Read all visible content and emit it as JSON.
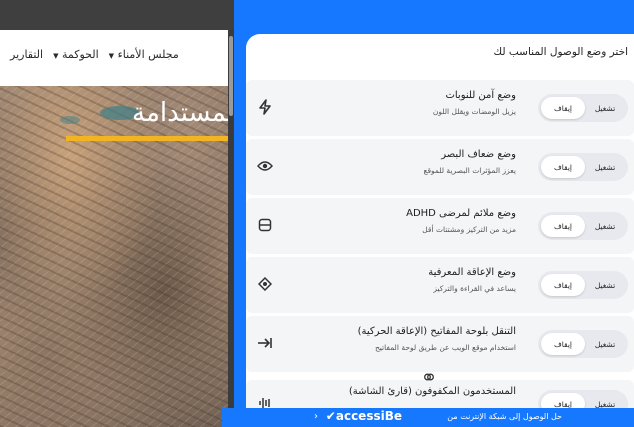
{
  "site": {
    "nav": [
      {
        "label": "مجلس الأمناء",
        "has_caret": true
      },
      {
        "label": "الحوكمة",
        "has_caret": true
      },
      {
        "label": "التقارير",
        "has_caret": false
      }
    ],
    "hero_title": "المستدامة"
  },
  "panel": {
    "heading": "اختر وضع الوصول المناسب لك",
    "profiles": [
      {
        "title": "وضع آمن للنوبات",
        "desc": "يزيل الومضات ويقلل اللون",
        "icon": "bolt-icon",
        "off_label": "إيقاف",
        "on_label": "تشغيل"
      },
      {
        "title": "وضع ضعاف البصر",
        "desc": "يعزز المؤثرات البصرية للموقع",
        "icon": "eye-icon",
        "off_label": "إيقاف",
        "on_label": "تشغيل"
      },
      {
        "title": "وضع ملائم لمرضى ADHD",
        "desc": "مزيد من التركيز ومشتتات أقل",
        "icon": "focus-icon",
        "off_label": "إيقاف",
        "on_label": "تشغيل"
      },
      {
        "title": "وضع الإعاقة المعرفية",
        "desc": "يساعد في القراءة والتركيز",
        "icon": "target-icon",
        "off_label": "إيقاف",
        "on_label": "تشغيل"
      },
      {
        "title": "التنقل بلوحة المفاتيح (الإعاقة الحركية)",
        "desc": "استخدام موقع الويب عن طريق لوحة المفاتيح",
        "icon": "keyboard-arrow-icon",
        "off_label": "إيقاف",
        "on_label": "تشغيل"
      },
      {
        "title": "المستخدمون المكفوفون (قارئ الشاشة)",
        "desc": "",
        "icon": "audio-wave-icon",
        "off_label": "إيقاف",
        "on_label": "تشغيل"
      }
    ],
    "link_icon": "link-icon"
  },
  "footer": {
    "text": "حل الوصول إلى شبكة الإنترنت من",
    "brand": "✔accessiBe",
    "chevron": "‹"
  },
  "colors": {
    "accent": "#1677ff",
    "highlight": "#f2b423"
  }
}
